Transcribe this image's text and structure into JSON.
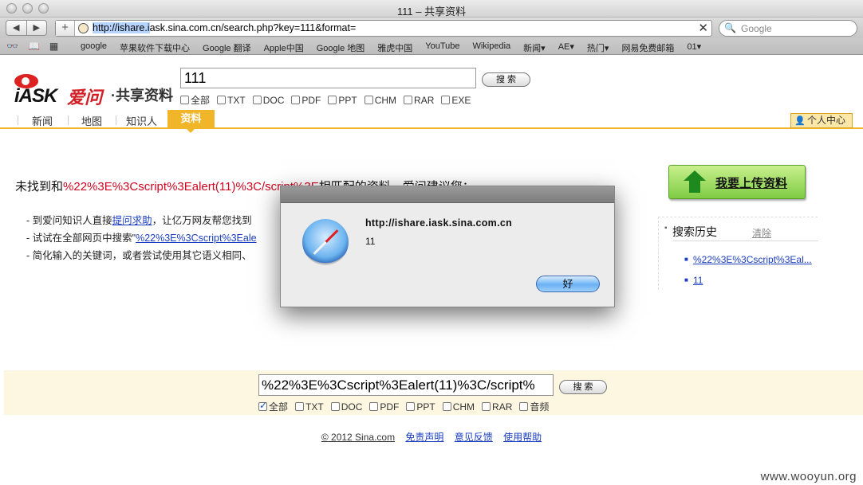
{
  "window": {
    "title": "111 – 共享资料"
  },
  "browser": {
    "back_label": "◀",
    "forward_label": "▶",
    "new_tab_label": "+",
    "url_selected": "http://ishare.i",
    "url_rest": "ask.sina.com.cn/search.php?key=111&format=",
    "url_clear_label": "✕",
    "search_icon": "🔍",
    "search_placeholder": "Google",
    "reader_icon": "👓",
    "bookmarks_icon": "📖",
    "topsites_icon": "▦",
    "bookmarks": [
      "google",
      "苹果软件下载中心",
      "Google 翻译",
      "Apple中国",
      "Google 地图",
      "雅虎中国",
      "YouTube",
      "Wikipedia",
      "新闻▾",
      "AE▾",
      "热门▾",
      "网易免费邮箱",
      "01▾"
    ]
  },
  "logo": {
    "iask": "iASK",
    "aiwen": "爱问",
    "share": "·共享资料"
  },
  "top_search": {
    "value": "111",
    "button": "搜 索",
    "filters": [
      {
        "label": "全部",
        "checked": false
      },
      {
        "label": "TXT",
        "checked": false
      },
      {
        "label": "DOC",
        "checked": false
      },
      {
        "label": "PDF",
        "checked": false
      },
      {
        "label": "PPT",
        "checked": false
      },
      {
        "label": "CHM",
        "checked": false
      },
      {
        "label": "RAR",
        "checked": false
      },
      {
        "label": "EXE",
        "checked": false
      }
    ]
  },
  "nav": {
    "tabs": [
      "新闻",
      "地图",
      "知识人"
    ],
    "active": "资料",
    "personal": "个人中心"
  },
  "result": {
    "prefix": "未找到和",
    "keyword": "%22%3E%3Cscript%3Ealert(11)%3C/script%3E",
    "suffix": "相匹配的资料，爱问建议您：",
    "s1_prefix": "- 到爱问知识人直接",
    "s1_link": "提问求助",
    "s1_suffix": "，让亿万网友帮您找到",
    "s2_prefix": "- 试试在全部网页中搜索\"",
    "s2_link": "%22%3E%3Cscript%3Eale",
    "s3": "- 简化输入的关键词，或者尝试使用其它语义相同、"
  },
  "upload": {
    "label": "我要上传资料"
  },
  "history": {
    "title": "搜索历史",
    "clear": "清除",
    "items": [
      "%22%3E%3Cscript%3Eal...",
      "11"
    ]
  },
  "dialog": {
    "title": "http://ishare.iask.sina.com.cn",
    "message": "11",
    "ok": "好"
  },
  "bottom_search": {
    "value": "%22%3E%3Cscript%3Ealert(11)%3C/script%",
    "button": "搜 索",
    "filters": [
      {
        "label": "全部",
        "checked": true
      },
      {
        "label": "TXT",
        "checked": false
      },
      {
        "label": "DOC",
        "checked": false
      },
      {
        "label": "PDF",
        "checked": false
      },
      {
        "label": "PPT",
        "checked": false
      },
      {
        "label": "CHM",
        "checked": false
      },
      {
        "label": "RAR",
        "checked": false
      },
      {
        "label": "音频",
        "checked": false
      }
    ]
  },
  "footer": {
    "copyright": "© 2012 Sina.com",
    "links": [
      "免责声明",
      "意见反馈",
      "使用帮助"
    ]
  },
  "watermark": "www.wooyun.org"
}
